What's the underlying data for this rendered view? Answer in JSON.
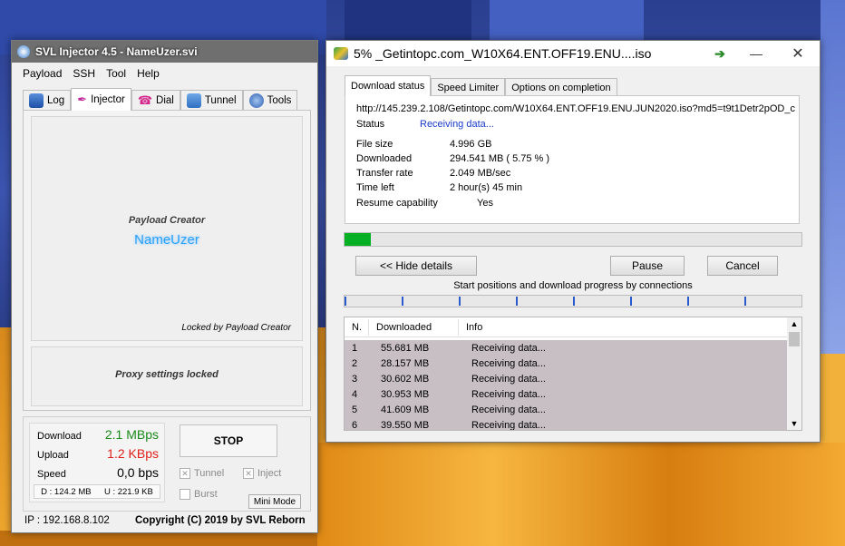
{
  "svl": {
    "title": "SVL Injector 4.5 - NameUzer.svi",
    "menu": [
      "Payload",
      "SSH",
      "Tool",
      "Help"
    ],
    "tabs": [
      "Log",
      "Injector",
      "Dial",
      "Tunnel",
      "Tools"
    ],
    "active_tab": "Injector",
    "payload_creator_label": "Payload Creator",
    "payload_creator_name": "NameUzer",
    "locked_label": "Locked by Payload Creator",
    "proxy_locked_label": "Proxy settings locked",
    "stats": {
      "download_label": "Download",
      "download_value": "2.1 MBps",
      "upload_label": "Upload",
      "upload_value": "1.2 KBps",
      "speed_label": "Speed",
      "speed_value": "0,0 bps",
      "d_total": "D : 124.2 MB",
      "u_total": "U : 221.9 KB"
    },
    "stop_button": "STOP",
    "tunnel_label": "Tunnel",
    "inject_label": "Inject",
    "burst_label": "Burst",
    "mini_mode_button": "Mini Mode",
    "ip_text": "IP : 192.168.8.102",
    "copyright": "Copyright (C) 2019 by SVL Reborn",
    "colors": {
      "download": "#1a8a1a",
      "upload": "#e0201a",
      "nameuzer": "#2aa0ff"
    }
  },
  "download": {
    "title": "5% _Getintopc.com_W10X64.ENT.OFF19.ENU....iso",
    "tabs": [
      "Download status",
      "Speed Limiter",
      "Options on completion"
    ],
    "url": "http://145.239.2.108/Getintopc.com/W10X64.ENT.OFF19.ENU.JUN2020.iso?md5=t9t1Detr2pOD_c",
    "status_label": "Status",
    "status_value": "Receiving data...",
    "file_size_label": "File size",
    "file_size_value": "4.996  GB",
    "downloaded_label": "Downloaded",
    "downloaded_value": "294.541  MB  ( 5.75 % )",
    "transfer_rate_label": "Transfer rate",
    "transfer_rate_value": "2.049  MB/sec",
    "time_left_label": "Time left",
    "time_left_value": "2 hour(s) 45 min",
    "resume_label": "Resume capability",
    "resume_value": "Yes",
    "progress_fraction": 0.0575,
    "hide_details_button": "<< Hide details",
    "pause_button": "Pause",
    "cancel_button": "Cancel",
    "connections_caption": "Start positions and download progress by connections",
    "table_headers": [
      "N.",
      "Downloaded",
      "Info"
    ],
    "rows": [
      {
        "n": "1",
        "downloaded": "55.681  MB",
        "info": "Receiving data..."
      },
      {
        "n": "2",
        "downloaded": "28.157  MB",
        "info": "Receiving data..."
      },
      {
        "n": "3",
        "downloaded": "30.602  MB",
        "info": "Receiving data..."
      },
      {
        "n": "4",
        "downloaded": "30.953  MB",
        "info": "Receiving data..."
      },
      {
        "n": "5",
        "downloaded": "41.609  MB",
        "info": "Receiving data..."
      },
      {
        "n": "6",
        "downloaded": "39.550  MB",
        "info": "Receiving data..."
      }
    ],
    "colors": {
      "progress": "#06b025",
      "status_link": "#1a3ccc",
      "row_bg": "#c7bfc4"
    }
  }
}
